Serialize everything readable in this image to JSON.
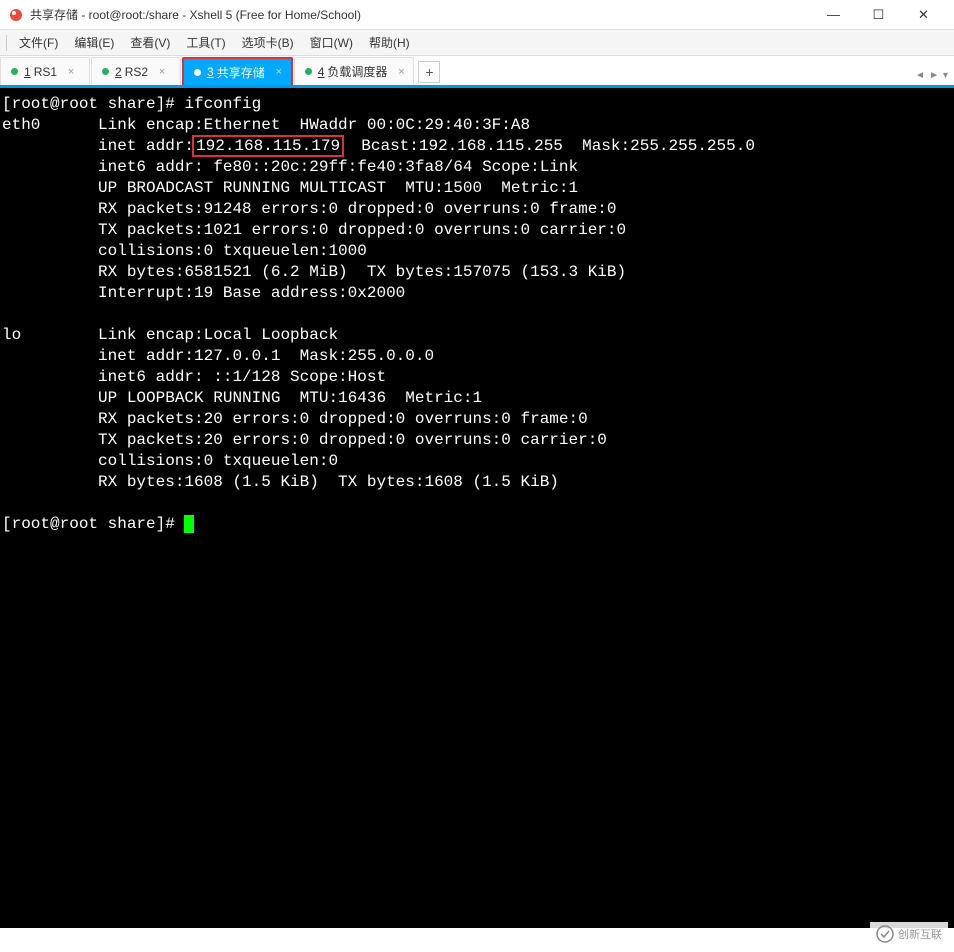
{
  "titlebar": {
    "title": "共享存储 - root@root:/share - Xshell 5 (Free for Home/School)"
  },
  "window_controls": {
    "minimize": "—",
    "maximize": "☐",
    "close": "✕"
  },
  "menubar": {
    "file": "文件(F)",
    "edit": "编辑(E)",
    "view": "查看(V)",
    "tools": "工具(T)",
    "tabs": "选项卡(B)",
    "window": "窗口(W)",
    "help": "帮助(H)"
  },
  "tabs": {
    "items": [
      {
        "num": "1",
        "label": "RS1"
      },
      {
        "num": "2",
        "label": "RS2"
      },
      {
        "num": "3",
        "label": "共享存储"
      },
      {
        "num": "4",
        "label": "负载调度器"
      }
    ],
    "active_index": 2,
    "add": "+",
    "nav_left": "◄",
    "nav_right": "►",
    "nav_menu": "▾"
  },
  "terminal": {
    "prompt1": "[root@root share]# ",
    "cmd1": "ifconfig",
    "eth0_label": "eth0",
    "line_encap": "Link encap:Ethernet  HWaddr 00:0C:29:40:3F:A8",
    "line_inet_pre": "inet addr:",
    "highlighted_ip": "192.168.115.179",
    "line_inet_post": "  Bcast:192.168.115.255  Mask:255.255.255.0",
    "line_inet6": "inet6 addr: fe80::20c:29ff:fe40:3fa8/64 Scope:Link",
    "line_flags": "UP BROADCAST RUNNING MULTICAST  MTU:1500  Metric:1",
    "line_rx": "RX packets:91248 errors:0 dropped:0 overruns:0 frame:0",
    "line_tx": "TX packets:1021 errors:0 dropped:0 overruns:0 carrier:0",
    "line_coll": "collisions:0 txqueuelen:1000",
    "line_bytes": "RX bytes:6581521 (6.2 MiB)  TX bytes:157075 (153.3 KiB)",
    "line_int": "Interrupt:19 Base address:0x2000",
    "lo_label": "lo",
    "lo_encap": "Link encap:Local Loopback",
    "lo_inet": "inet addr:127.0.0.1  Mask:255.0.0.0",
    "lo_inet6": "inet6 addr: ::1/128 Scope:Host",
    "lo_flags": "UP LOOPBACK RUNNING  MTU:16436  Metric:1",
    "lo_rx": "RX packets:20 errors:0 dropped:0 overruns:0 frame:0",
    "lo_tx": "TX packets:20 errors:0 dropped:0 overruns:0 carrier:0",
    "lo_coll": "collisions:0 txqueuelen:0",
    "lo_bytes": "RX bytes:1608 (1.5 KiB)  TX bytes:1608 (1.5 KiB)",
    "prompt2": "[root@root share]# "
  },
  "watermark": {
    "text": "创新互联"
  }
}
